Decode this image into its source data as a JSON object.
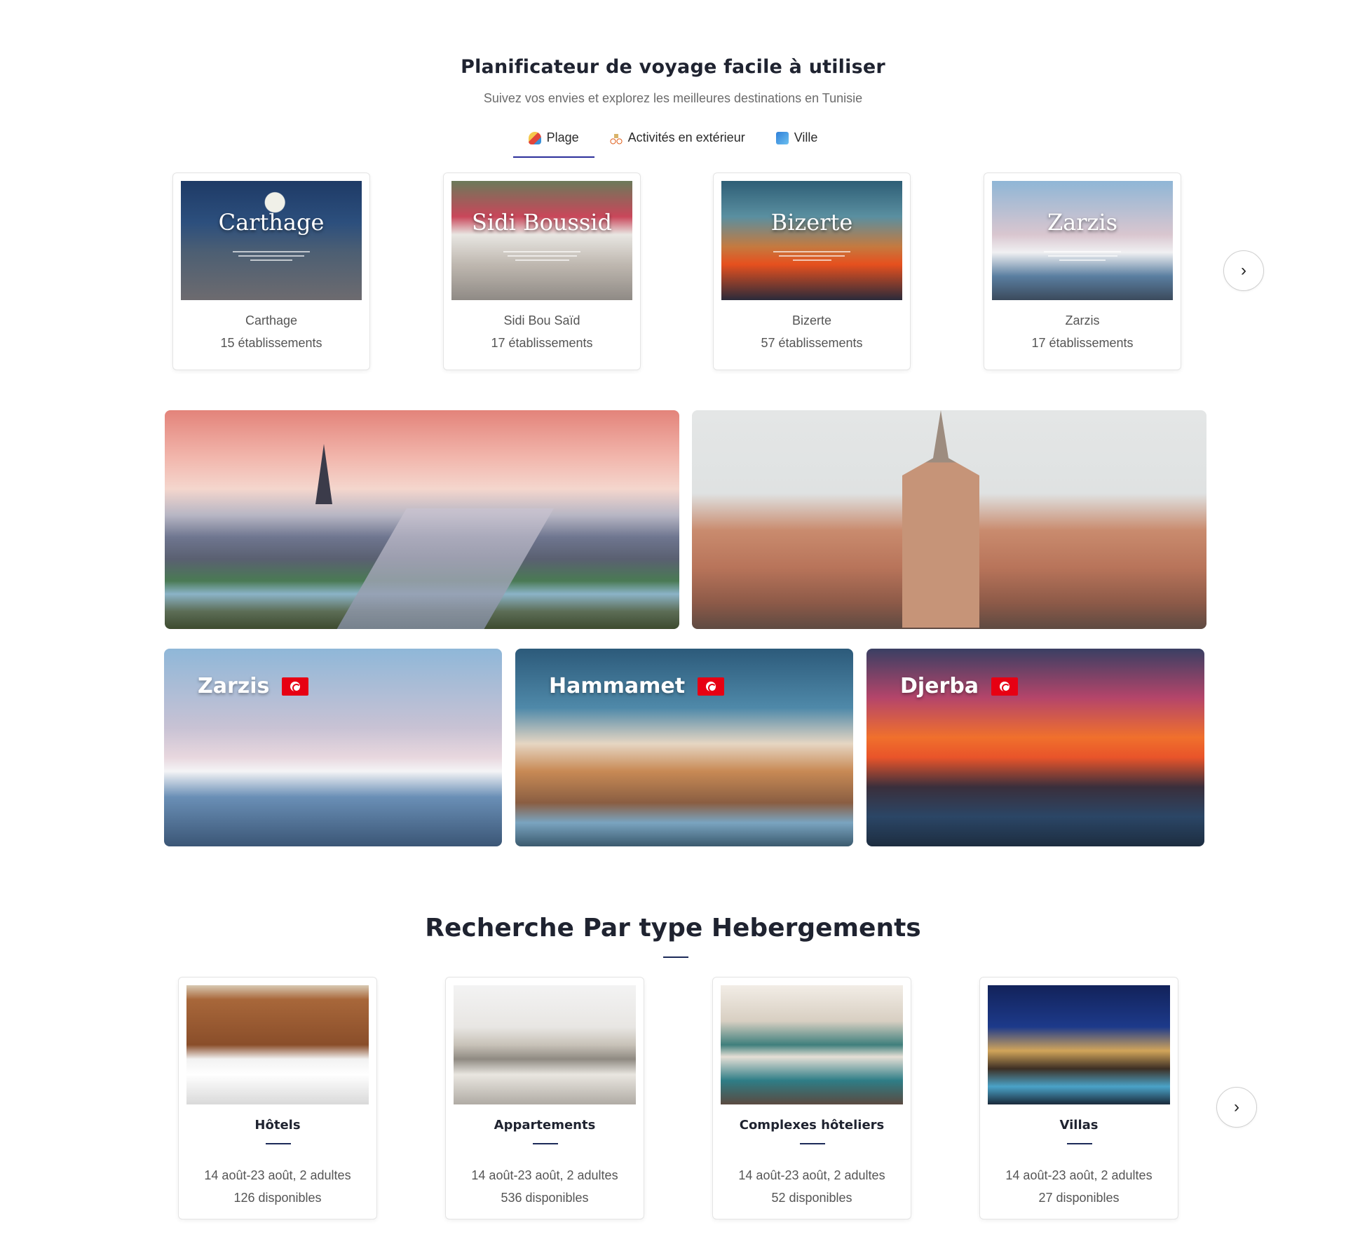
{
  "planner": {
    "title": "Planificateur de voyage facile à utiliser",
    "subtitle": "Suivez vos envies et explorez les meilleures destinations en Tunisie",
    "tabs": [
      {
        "label": "Plage",
        "icon": "beach-umbrella-icon",
        "active": true
      },
      {
        "label": "Activités en extérieur",
        "icon": "bicycle-icon",
        "active": false
      },
      {
        "label": "Ville",
        "icon": "city-icon",
        "active": false
      }
    ],
    "next_label": "›"
  },
  "destinations": [
    {
      "image_title": "Carthage",
      "name": "Carthage",
      "count": "15 établissements"
    },
    {
      "image_title": "Sidi Boussid",
      "name": "Sidi Bou Saïd",
      "count": "17 établissements"
    },
    {
      "image_title": "Bizerte",
      "name": "Bizerte",
      "count": "57 établissements"
    },
    {
      "image_title": "Zarzis",
      "name": "Zarzis",
      "count": "17 établissements"
    }
  ],
  "featured": [
    {
      "name": "Zarzis",
      "flag": "tunisia-flag-icon"
    },
    {
      "name": "Hammamet",
      "flag": "tunisia-flag-icon"
    },
    {
      "name": "Djerba",
      "flag": "tunisia-flag-icon"
    }
  ],
  "accommodation": {
    "title": "Recherche Par type Hebergements",
    "next_label": "›",
    "types": [
      {
        "name": "Hôtels",
        "dates": "14 août-23 août, 2 adultes",
        "count": "126 disponibles"
      },
      {
        "name": "Appartements",
        "dates": "14 août-23 août, 2 adultes",
        "count": "536 disponibles"
      },
      {
        "name": "Complexes hôteliers",
        "dates": "14 août-23 août, 2 adultes",
        "count": "52 disponibles"
      },
      {
        "name": "Villas",
        "dates": "14 août-23 août, 2 adultes",
        "count": "27 disponibles"
      }
    ]
  },
  "colors": {
    "accent": "#2b2f9a",
    "heading": "#1f2330",
    "rule": "#1c2a58",
    "flag": "#e70013"
  }
}
